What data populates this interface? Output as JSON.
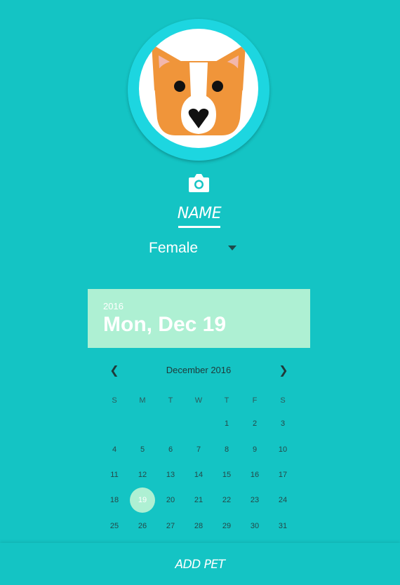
{
  "avatar": {
    "icon": "corgi-dog-icon"
  },
  "photo": {
    "icon": "camera-icon"
  },
  "name_field": {
    "placeholder": "NAME"
  },
  "gender": {
    "selected": "Female"
  },
  "date_header": {
    "year": "2016",
    "full_date": "Mon, Dec 19"
  },
  "calendar": {
    "prev_icon": "chevron-left-icon",
    "next_icon": "chevron-right-icon",
    "month_label": "December 2016",
    "weekdays": [
      "S",
      "M",
      "T",
      "W",
      "T",
      "F",
      "S"
    ],
    "weeks": [
      [
        "",
        "",
        "",
        "",
        "1",
        "2",
        "3"
      ],
      [
        "4",
        "5",
        "6",
        "7",
        "8",
        "9",
        "10"
      ],
      [
        "11",
        "12",
        "13",
        "14",
        "15",
        "16",
        "17"
      ],
      [
        "18",
        "19",
        "20",
        "21",
        "22",
        "23",
        "24"
      ],
      [
        "25",
        "26",
        "27",
        "28",
        "29",
        "30",
        "31"
      ]
    ],
    "selected_day": "19"
  },
  "action": {
    "add_pet_label": "ADD PET"
  },
  "colors": {
    "background": "#14c4c4",
    "avatar_ring": "#1dd6e0",
    "date_header": "#aef0d3",
    "selected_day": "#aef0d3"
  }
}
